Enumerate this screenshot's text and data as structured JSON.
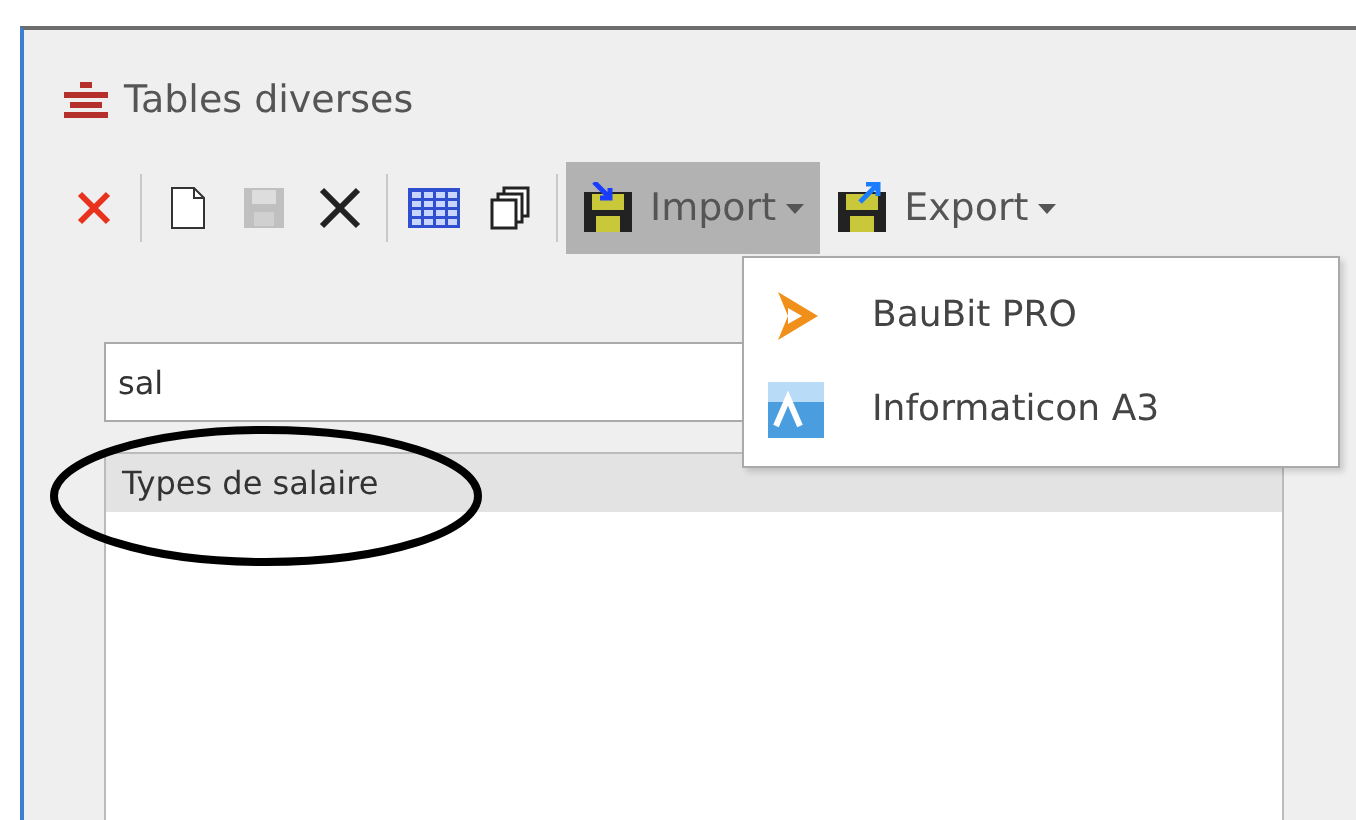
{
  "window": {
    "title": "Tables diverses"
  },
  "toolbar": [
    {
      "kind": "icon",
      "disabled": false
    },
    {
      "kind": "separator"
    },
    {
      "kind": "icon",
      "disabled": false
    },
    {
      "kind": "icon",
      "disabled": true
    },
    {
      "kind": "icon",
      "disabled": false
    },
    {
      "kind": "separator"
    },
    {
      "kind": "icon",
      "disabled": false
    },
    {
      "kind": "icon",
      "disabled": false
    },
    {
      "kind": "separator"
    },
    {
      "kind": "menu",
      "label": "Import",
      "expanded": true
    },
    {
      "kind": "menu",
      "label": "Export",
      "expanded": false
    }
  ],
  "import_menu": [
    {
      "label": "BauBit PRO"
    },
    {
      "label": "Informaticon A3"
    }
  ],
  "search": {
    "value": "sal"
  },
  "list": {
    "columns": [
      "Types de salaire"
    ]
  }
}
